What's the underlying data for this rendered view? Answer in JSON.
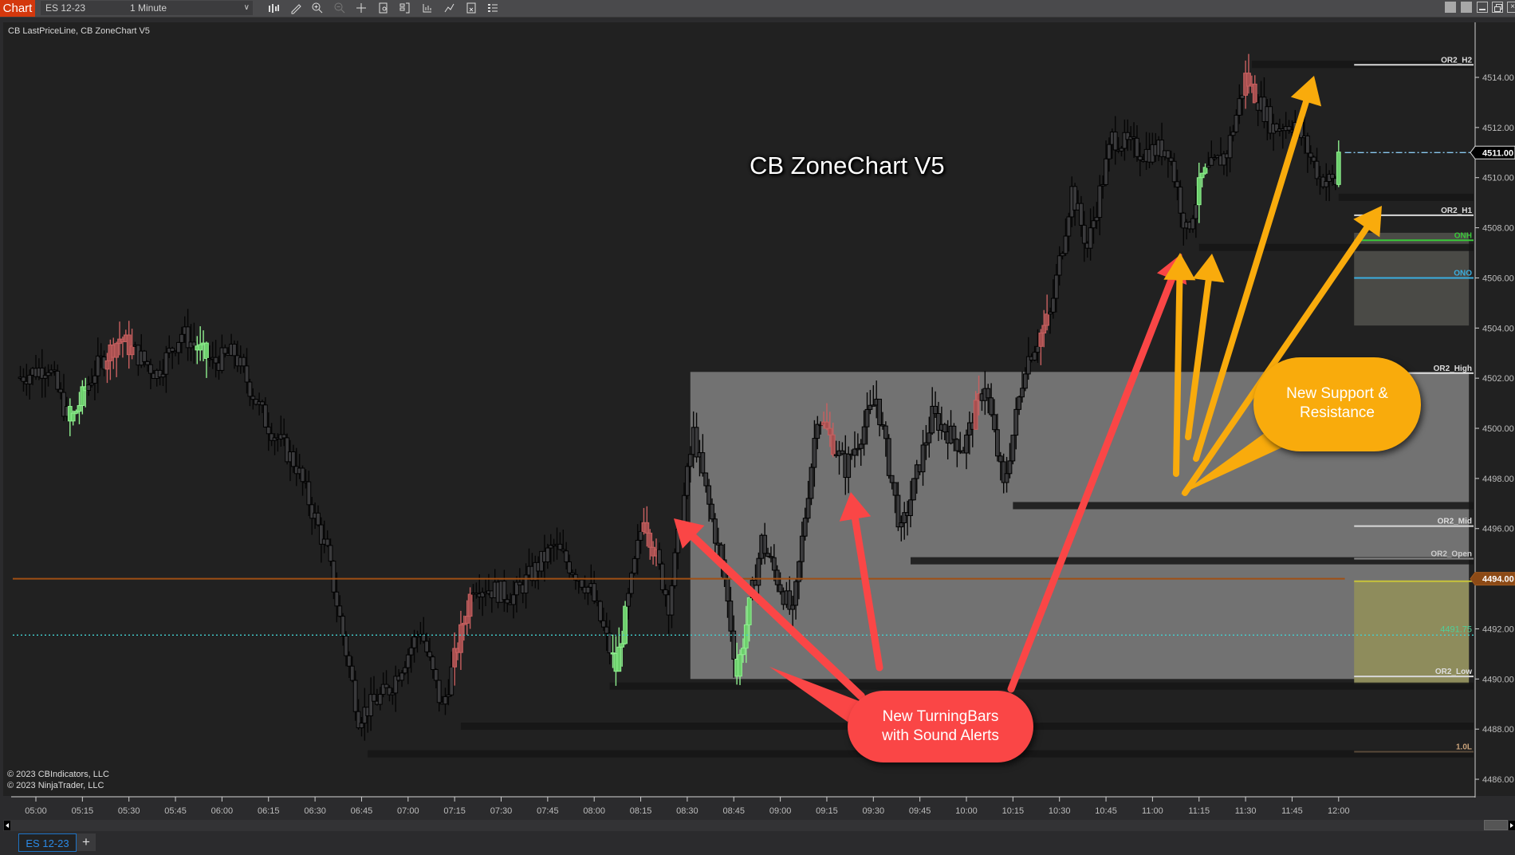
{
  "window": {
    "app_tab": "Chart",
    "instrument": "ES 12-23",
    "interval": "1 Minute",
    "toolbar_icons": [
      "bar-type-icon",
      "drawing-tool-icon",
      "zoom-in-icon",
      "zoom-out-icon",
      "crosshair-icon",
      "data-box-icon",
      "chart-trader-icon",
      "indicators-icon",
      "strategies-icon",
      "properties-icon",
      "templates-icon"
    ],
    "window_controls": [
      "tile-icon",
      "tile-icon",
      "minimize-icon",
      "restore-icon",
      "close-icon"
    ]
  },
  "chart": {
    "indicators_label": "CB LastPriceLine, CB ZoneChart V5",
    "title": "CB ZoneChart V5",
    "copyright": [
      "© 2023 CBIndicators, LLC",
      "© 2023 NinjaTrader, LLC"
    ],
    "last_price": "4511.00",
    "marker_price": "4494.00",
    "dotted_line_value": "4491.75",
    "level_labels": [
      {
        "label": "OR2_H2",
        "price": 4514.5,
        "color": "#dddddd"
      },
      {
        "label": "OR2_H1",
        "price": 4508.5,
        "color": "#dddddd"
      },
      {
        "label": "ONH",
        "price": 4507.5,
        "color": "#39c839"
      },
      {
        "label": "ONO",
        "price": 4506.0,
        "color": "#3aaee0"
      },
      {
        "label": "OR2_High",
        "price": 4502.2,
        "color": "#dddddd"
      },
      {
        "label": "OR2_Mid",
        "price": 4496.1,
        "color": "#dddddd"
      },
      {
        "label": "OR2_Open",
        "price": 4494.8,
        "color": "#cccccc"
      },
      {
        "label": "OR2_Low",
        "price": 4490.1,
        "color": "#dddddd"
      },
      {
        "label": "1.0L",
        "price": 4487.1,
        "color": "#c9a27a"
      }
    ],
    "callouts": [
      {
        "text_line1": "New TurningBars",
        "text_line2": "with Sound Alerts",
        "color": "#fa4646"
      },
      {
        "text_line1": "New Support &",
        "text_line2": "Resistance",
        "color": "#f9ab0c"
      }
    ],
    "colors": {
      "accent": "#d4380d",
      "up_turn": "#7be07b",
      "down_turn": "#c85a5a",
      "candle": "#3a3a3c",
      "last_price_line": "#8ac8f0",
      "marker_line": "#a04f14",
      "cyan_dotted": "#43d0d0"
    }
  },
  "chart_data": {
    "type": "candlestick",
    "title": "CB ZoneChart V5",
    "instrument": "ES 12-23",
    "interval": "1 Minute",
    "x_ticks": [
      "05:00",
      "05:15",
      "05:30",
      "05:45",
      "06:00",
      "06:15",
      "06:30",
      "06:45",
      "07:00",
      "07:15",
      "07:30",
      "07:45",
      "08:00",
      "08:15",
      "08:30",
      "08:45",
      "09:00",
      "09:15",
      "09:30",
      "09:45",
      "10:00",
      "10:15",
      "10:30",
      "10:45",
      "11:00",
      "11:15",
      "11:30",
      "11:45",
      "12:00"
    ],
    "y_ticks": [
      4486,
      4488,
      4490,
      4492,
      4494,
      4496,
      4498,
      4500,
      4502,
      4504,
      4506,
      4508,
      4510,
      4512,
      4514
    ],
    "ylim": [
      4485.5,
      4515.5
    ],
    "price_path": [
      {
        "t": "04:55",
        "p": 4502.0
      },
      {
        "t": "05:05",
        "p": 4502.5
      },
      {
        "t": "05:12",
        "p": 4500.2
      },
      {
        "t": "05:20",
        "p": 4502.3
      },
      {
        "t": "05:28",
        "p": 4503.6
      },
      {
        "t": "05:40",
        "p": 4502.2
      },
      {
        "t": "05:48",
        "p": 4503.8
      },
      {
        "t": "05:58",
        "p": 4502.6
      },
      {
        "t": "06:05",
        "p": 4503.0
      },
      {
        "t": "06:15",
        "p": 4500.3
      },
      {
        "t": "06:25",
        "p": 4498.5
      },
      {
        "t": "06:35",
        "p": 4495.0
      },
      {
        "t": "06:45",
        "p": 4488.5
      },
      {
        "t": "06:55",
        "p": 4489.6
      },
      {
        "t": "07:05",
        "p": 4492.0
      },
      {
        "t": "07:12",
        "p": 4488.8
      },
      {
        "t": "07:22",
        "p": 4493.8
      },
      {
        "t": "07:35",
        "p": 4493.3
      },
      {
        "t": "07:48",
        "p": 4495.3
      },
      {
        "t": "08:00",
        "p": 4493.5
      },
      {
        "t": "08:08",
        "p": 4490.4
      },
      {
        "t": "08:17",
        "p": 4496.6
      },
      {
        "t": "08:25",
        "p": 4493.0
      },
      {
        "t": "08:33",
        "p": 4499.8
      },
      {
        "t": "08:43",
        "p": 4494.0
      },
      {
        "t": "08:47",
        "p": 4490.2
      },
      {
        "t": "08:55",
        "p": 4495.5
      },
      {
        "t": "09:05",
        "p": 4492.5
      },
      {
        "t": "09:13",
        "p": 4500.6
      },
      {
        "t": "09:22",
        "p": 4498.4
      },
      {
        "t": "09:32",
        "p": 4501.2
      },
      {
        "t": "09:40",
        "p": 4495.8
      },
      {
        "t": "09:50",
        "p": 4500.5
      },
      {
        "t": "10:00",
        "p": 4499.2
      },
      {
        "t": "10:07",
        "p": 4501.8
      },
      {
        "t": "10:13",
        "p": 4497.6
      },
      {
        "t": "10:20",
        "p": 4502.6
      },
      {
        "t": "10:28",
        "p": 4504.5
      },
      {
        "t": "10:35",
        "p": 4509.5
      },
      {
        "t": "10:40",
        "p": 4507.2
      },
      {
        "t": "10:48",
        "p": 4511.6
      },
      {
        "t": "10:58",
        "p": 4511.0
      },
      {
        "t": "11:06",
        "p": 4511.2
      },
      {
        "t": "11:12",
        "p": 4507.8
      },
      {
        "t": "11:17",
        "p": 4510.0
      },
      {
        "t": "11:25",
        "p": 4511.0
      },
      {
        "t": "11:31",
        "p": 4514.0
      },
      {
        "t": "11:40",
        "p": 4512.0
      },
      {
        "t": "11:47",
        "p": 4512.2
      },
      {
        "t": "11:55",
        "p": 4510.0
      },
      {
        "t": "12:00",
        "p": 4509.8
      },
      {
        "t": "12:01",
        "p": 4511.0
      }
    ],
    "zones": [
      {
        "name": "main-zone",
        "from": "08:31",
        "to": "12:42",
        "top": 4502.25,
        "bottom": 4490.0
      },
      {
        "name": "onh-ono-zone",
        "from": "12:05",
        "to": "12:42",
        "top": 4507.8,
        "bottom": 4504.1
      },
      {
        "name": "or-low-yellow-zone",
        "from": "12:05",
        "to": "12:42",
        "top": 4493.9,
        "bottom": 4489.8
      }
    ],
    "levels": [
      {
        "name": "last-price",
        "value": 4511.0
      },
      {
        "name": "marker",
        "value": 4494.0
      },
      {
        "name": "dotted",
        "value": 4491.75
      }
    ],
    "support_resistance_lines": [
      {
        "from": "11:32",
        "value": 4514.5
      },
      {
        "from": "12:00",
        "value": 4509.2
      },
      {
        "from": "11:15",
        "value": 4507.2
      },
      {
        "from": "10:15",
        "value": 4496.9
      },
      {
        "from": "09:42",
        "value": 4494.7
      },
      {
        "from": "08:05",
        "value": 4489.7
      },
      {
        "from": "07:17",
        "value": 4488.1
      },
      {
        "from": "06:47",
        "value": 4487.0
      }
    ]
  },
  "bottom": {
    "tab_label": "ES 12-23",
    "add_tab": "+"
  }
}
